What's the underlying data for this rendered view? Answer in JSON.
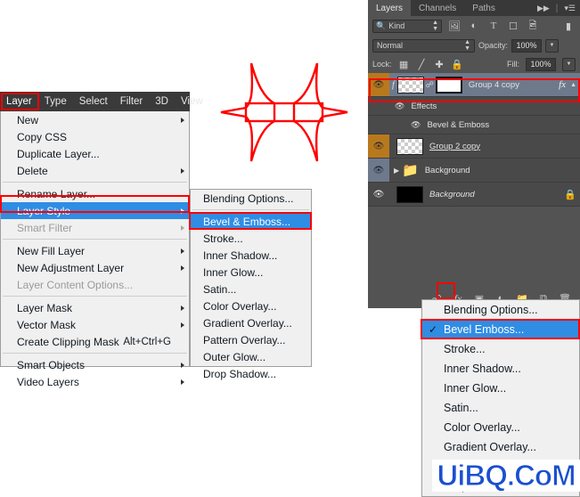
{
  "menubar": {
    "items": [
      {
        "label": "Layer",
        "active": true
      },
      {
        "label": "Type",
        "active": false
      },
      {
        "label": "Select",
        "active": false
      },
      {
        "label": "Filter",
        "active": false
      },
      {
        "label": "3D",
        "active": false
      },
      {
        "label": "View",
        "active": false
      }
    ]
  },
  "layer_menu": {
    "items": [
      {
        "label": "New",
        "arrow": true
      },
      {
        "label": "Copy CSS",
        "arrow": false
      },
      {
        "label": "Duplicate Layer...",
        "arrow": false
      },
      {
        "label": "Delete",
        "arrow": true
      },
      {
        "label": "Rename Layer...",
        "arrow": false
      },
      {
        "label": "Layer Style",
        "arrow": true,
        "selected": true
      },
      {
        "label": "Smart Filter",
        "arrow": true,
        "disabled": true
      },
      {
        "label": "New Fill Layer",
        "arrow": true
      },
      {
        "label": "New Adjustment Layer",
        "arrow": true
      },
      {
        "label": "Layer Content Options...",
        "arrow": false,
        "disabled": true
      },
      {
        "label": "Layer Mask",
        "arrow": true
      },
      {
        "label": "Vector Mask",
        "arrow": true
      },
      {
        "label": "Create Clipping Mask",
        "arrow": false,
        "shortcut": "Alt+Ctrl+G"
      },
      {
        "label": "Smart Objects",
        "arrow": true
      },
      {
        "label": "Video Layers",
        "arrow": true
      }
    ]
  },
  "style_submenu": {
    "items": [
      {
        "label": "Blending Options..."
      },
      {
        "label": "Bevel & Emboss...",
        "selected": true
      },
      {
        "label": "Stroke..."
      },
      {
        "label": "Inner Shadow..."
      },
      {
        "label": "Inner Glow..."
      },
      {
        "label": "Satin..."
      },
      {
        "label": "Color Overlay..."
      },
      {
        "label": "Gradient Overlay..."
      },
      {
        "label": "Pattern Overlay..."
      },
      {
        "label": "Outer Glow..."
      },
      {
        "label": "Drop Shadow..."
      }
    ]
  },
  "layers_panel": {
    "tabs": [
      {
        "label": "Layers",
        "active": true
      },
      {
        "label": "Channels",
        "active": false
      },
      {
        "label": "Paths",
        "active": false
      }
    ],
    "filter": {
      "kind_label": "Kind",
      "search_icon": "search-icon"
    },
    "blend": {
      "mode": "Normal",
      "opacity_label": "Opacity:",
      "opacity_value": "100%"
    },
    "lock": {
      "label": "Lock:",
      "fill_label": "Fill:",
      "fill_value": "100%"
    },
    "rows": [
      {
        "name": "Group 4 copy",
        "selected": true,
        "fx": "fx",
        "kind": "group-with-mask"
      },
      {
        "name": "Effects",
        "kind": "effects-header"
      },
      {
        "name": "Bevel & Emboss",
        "kind": "effect-item"
      },
      {
        "name": "Group 2 copy",
        "kind": "layer-checker",
        "underline": true
      },
      {
        "name": "Background",
        "kind": "folder"
      },
      {
        "name": "Background",
        "kind": "locked-background",
        "italic": true,
        "locked": true
      }
    ]
  },
  "fx_menu": {
    "items": [
      {
        "label": "Blending Options...",
        "checked": false
      },
      {
        "label": "Bevel  Emboss...",
        "checked": true,
        "selected": true
      },
      {
        "label": "Stroke...",
        "checked": false
      },
      {
        "label": "Inner Shadow...",
        "checked": false
      },
      {
        "label": "Inner Glow...",
        "checked": false
      },
      {
        "label": "Satin...",
        "checked": false
      },
      {
        "label": "Color Overlay...",
        "checked": false
      },
      {
        "label": "Gradient Overlay...",
        "checked": false
      },
      {
        "label": "Pattern Overlay...",
        "checked": false
      },
      {
        "label": "Drop Shadow...",
        "checked": false
      }
    ]
  },
  "watermark": {
    "text": "UiBQ.CoM"
  },
  "colors": {
    "highlight_red": "#ff0000",
    "menu_selection_blue": "#2f8de4",
    "panel_bg": "#535353",
    "row_selected": "#6e7a8c",
    "eye_highlight": "#b8791e",
    "watermark_blue": "#1a4fd0"
  }
}
